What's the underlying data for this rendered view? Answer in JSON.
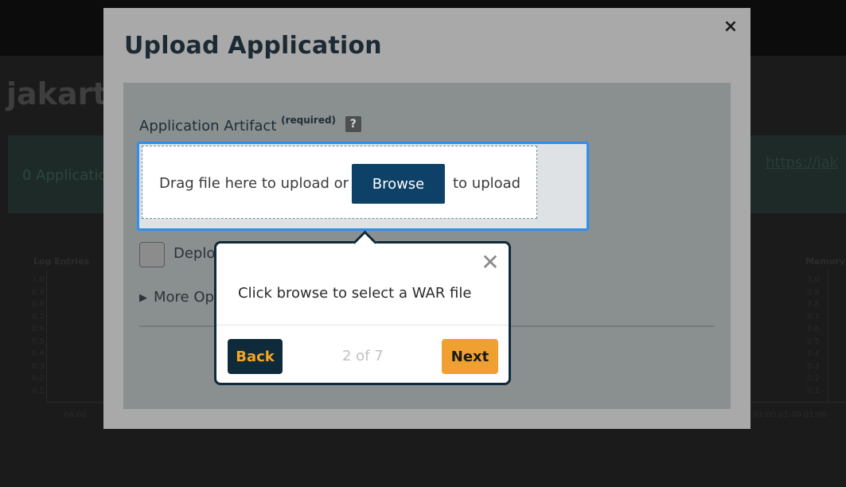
{
  "background": {
    "page_title": "jakarta",
    "banner_text": "0 Application",
    "link_text": "https://jak",
    "chart_left_label": "Log Entries",
    "chart_right_label": "Memory",
    "left_ticks": [
      "1.0",
      "0.9",
      "0.8",
      "0.7",
      "0.6",
      "0.5",
      "0.4",
      "0.3",
      "0.2",
      "0.1"
    ],
    "right_ticks": [
      "1.0",
      "0.9",
      "0.8",
      "0.7",
      "0.6",
      "0.5",
      "0.4",
      "0.3",
      "0.2",
      "0.1"
    ],
    "x_ticks_left": "04:00",
    "x_ticks_right": "01:00 01:00 01:00"
  },
  "modal": {
    "title": "Upload Application",
    "close_glyph": "×",
    "field_label": "Application Artifact",
    "required_label": "(required)",
    "help_glyph": "?",
    "drop_text_before": "Drag file here to upload or",
    "browse_label": "Browse",
    "drop_text_after": "to upload",
    "checkbox_label": "Deplo",
    "more_options_label": "More Op",
    "more_options_glyph": "▶"
  },
  "tour": {
    "message": "Click browse to select a WAR file",
    "close_glyph": "✕",
    "back_label": "Back",
    "next_label": "Next",
    "counter": "2 of 7"
  },
  "colors": {
    "accent": "#0d4168",
    "tour_next": "#f0a030",
    "tour_back_text": "#f5a623",
    "dropzone_focus": "#2f8ff0"
  }
}
